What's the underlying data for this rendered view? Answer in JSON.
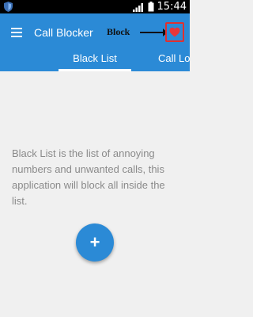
{
  "status_bar": {
    "time": "15:44",
    "icons": [
      "shield-icon",
      "signal-icon",
      "battery-icon"
    ]
  },
  "app_bar": {
    "title": "Call Blocker",
    "menu_icon": "hamburger-icon",
    "annotation": "Block",
    "action_icon": "heart-icon"
  },
  "tabs": [
    {
      "label": "Black List",
      "active": true
    },
    {
      "label": "Call Lo",
      "active": false
    }
  ],
  "main": {
    "message": "Black List is the list of annoying numbers and unwanted calls, this application will block all inside the list.",
    "fab_label": "+"
  },
  "colors": {
    "primary": "#2b8ad6",
    "background": "#f0f0f0",
    "text_muted": "#8a8a8a",
    "highlight": "#e03030"
  }
}
